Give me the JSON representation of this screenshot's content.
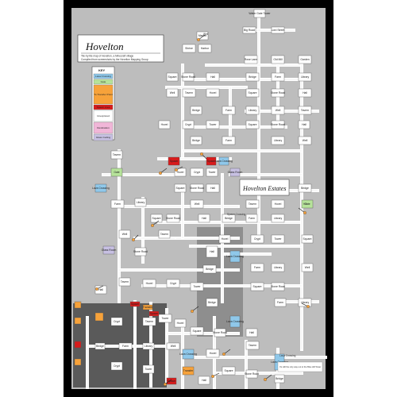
{
  "title": "Hovelton",
  "subtitle": "Tile-by-tile map of Hovelton, a Minecraft village",
  "credit": "Compiled from screenshots by the Hovelton Mapping Group",
  "district_label": "Hovelton Estates",
  "key": {
    "heading": "KEY",
    "entries": [
      {
        "label": "Lava Crossing",
        "color": "#8fc8ea"
      },
      {
        "label": "Gate",
        "color": "#b6e39a"
      },
      {
        "label": "To Transfer Point",
        "color": "#f7a23a"
      },
      {
        "label": "Spawn Area",
        "color": "#d81b1b"
      },
      {
        "label": "Unexplored",
        "color": "#ffffff"
      },
      {
        "label": "Destination",
        "color": "#f1b6d8"
      },
      {
        "label": "Glass Ceiling",
        "color": "#c7c0e2"
      }
    ]
  },
  "colors": {
    "frame": "#000000",
    "ground": "#bdbdbd",
    "dark_zone": "#5a5a5a",
    "mid_zone": "#8e8e8e",
    "room": "#ffffff",
    "corridor": "#ffffff",
    "orange_marker": "#f7a23a",
    "red_marker": "#d81b1b",
    "green_room": "#b6e39a",
    "blue_room": "#8fc8ea",
    "purple_room": "#c7c0e2",
    "pointer": "#1a1a1a"
  },
  "rooms": [
    {
      "name": "Water Gate Tower",
      "kind": "plain"
    },
    {
      "name": "Lord Street",
      "kind": "plain"
    },
    {
      "name": "Big Road",
      "kind": "plain"
    },
    {
      "name": "Shrine",
      "kind": "plain"
    },
    {
      "name": "Market",
      "kind": "plain"
    },
    {
      "name": "Harbor",
      "kind": "plain"
    },
    {
      "name": "Rose Lane",
      "kind": "plain"
    },
    {
      "name": "Old Mill",
      "kind": "plain"
    },
    {
      "name": "Garden",
      "kind": "plain"
    },
    {
      "name": "Square",
      "kind": "plain"
    },
    {
      "name": "Stone Road",
      "kind": "plain"
    },
    {
      "name": "Hall",
      "kind": "plain"
    },
    {
      "name": "Bridge",
      "kind": "plain"
    },
    {
      "name": "Farm",
      "kind": "plain"
    },
    {
      "name": "Library",
      "kind": "plain"
    },
    {
      "name": "Well",
      "kind": "plain"
    },
    {
      "name": "Tavern",
      "kind": "plain"
    },
    {
      "name": "Hovel",
      "kind": "plain"
    },
    {
      "name": "Gate",
      "kind": "green"
    },
    {
      "name": "Lava Crossing",
      "kind": "blue"
    },
    {
      "name": "Glass Room",
      "kind": "purple"
    },
    {
      "name": "Spawn",
      "kind": "red"
    },
    {
      "name": "Transfer",
      "kind": "orange"
    },
    {
      "name": "Crypt",
      "kind": "plain"
    },
    {
      "name": "Tower",
      "kind": "plain"
    }
  ],
  "annotations": [
    {
      "text": "Lava Crossing"
    },
    {
      "text": "It's still the only way out to the Blue Hill Tower"
    },
    {
      "text": "Spawn Crossing"
    },
    {
      "text": "Hill"
    },
    {
      "text": "Well"
    }
  ]
}
